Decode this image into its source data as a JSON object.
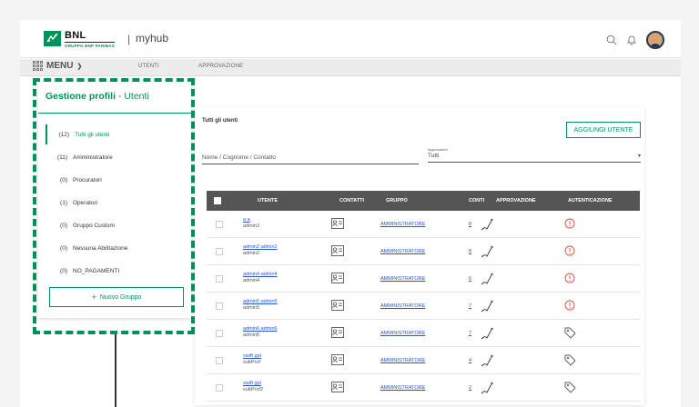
{
  "header": {
    "brand": "BNL",
    "brand_sub": "GRUPPO BNP PARIBAS",
    "separator": "|",
    "app_name": "myhub"
  },
  "nav": {
    "menu_label": "MENU",
    "links": [
      "UTENTI",
      "APPROVAZIONE"
    ]
  },
  "sidebar": {
    "title_bold": "Gestione profili",
    "title_rest": " - Utenti",
    "items": [
      {
        "count": "(12)",
        "label": "Tutti gli utenti"
      },
      {
        "count": "(11)",
        "label": "Amministratore"
      },
      {
        "count": "(0)",
        "label": "Procuratori"
      },
      {
        "count": "(1)",
        "label": "Operatori"
      },
      {
        "count": "(0)",
        "label": "Gruppo Custom"
      },
      {
        "count": "(0)",
        "label": "Nessuna Abilitazione"
      },
      {
        "count": "(0)",
        "label": "NO_PAGAMENTI"
      }
    ],
    "new_group_label": "Nuovo Gruppo"
  },
  "main": {
    "title": "Tutti gli utenti",
    "add_user_label": "AGGIUNGI UTENTE",
    "filter_name_placeholder": "Nome / Cognome / Contatto",
    "filter_approver_label": "Approvatore",
    "filter_approver_value": "Tutti",
    "columns": [
      "UTENTE",
      "CONTATTI",
      "GRUPPO",
      "CONTI",
      "APPROVAZIONE",
      "AUTENTICAZIONE"
    ],
    "rows": [
      {
        "name": "a a",
        "user": "admin3",
        "group": "AMMINISTRATORE",
        "conti": "8",
        "auth": "alert"
      },
      {
        "name": "admin2 admin2",
        "user": "admin2",
        "group": "AMMINISTRATORE",
        "conti": "8",
        "auth": "alert"
      },
      {
        "name": "admin4 admin4",
        "user": "admin4",
        "group": "AMMINISTRATORE",
        "conti": "6",
        "auth": "alert"
      },
      {
        "name": "admin5 admin5",
        "user": "admin5",
        "group": "AMMINISTRATORE",
        "conti": "7",
        "auth": "alert"
      },
      {
        "name": "admin6 admin6",
        "user": "admin6",
        "group": "AMMINISTRATORE",
        "conti": "7",
        "auth": "tag"
      },
      {
        "name": "swift gpi",
        "user": "subProf",
        "group": "AMMINISTRATORE",
        "conti": "4",
        "auth": "tag"
      },
      {
        "name": "swift gpi",
        "user": "subProf2",
        "group": "AMMINISTRATORE",
        "conti": "2",
        "auth": "tag"
      }
    ]
  },
  "colors": {
    "accent": "#00915a",
    "link": "#2a55c8",
    "alert": "#e04b3c",
    "header_bg": "#555555"
  }
}
